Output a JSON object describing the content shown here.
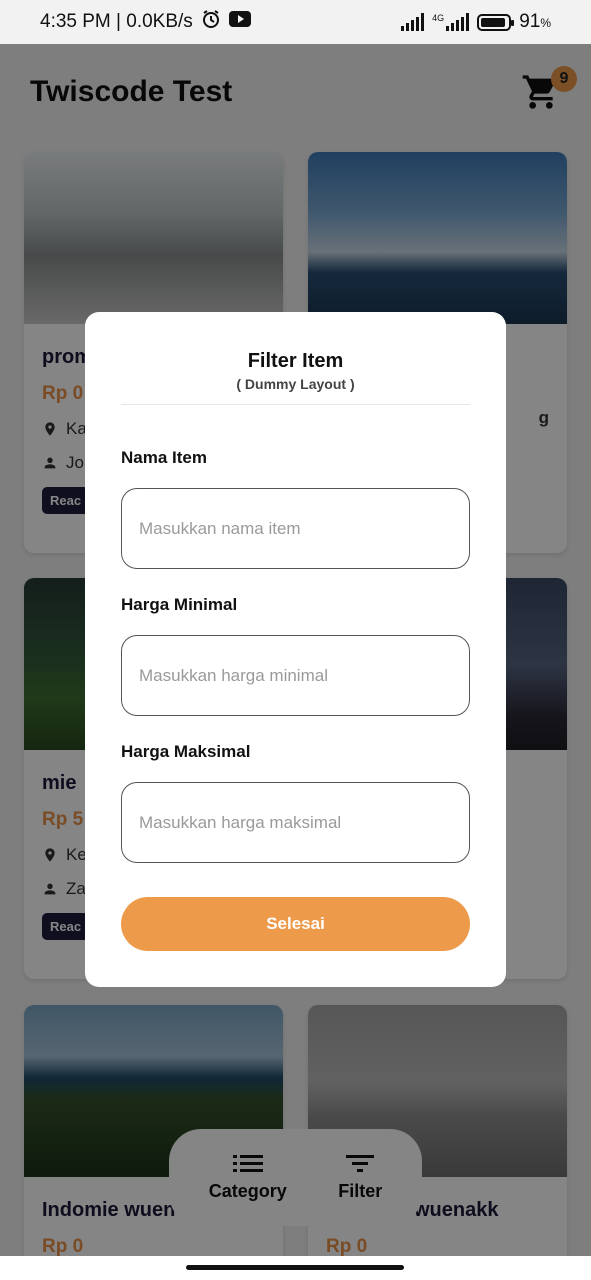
{
  "status_bar": {
    "time": "4:35 PM | 0.0KB/s",
    "network": "4G",
    "battery": "91",
    "battery_unit": "%"
  },
  "header": {
    "title": "Twiscode Test",
    "cart_count": "9"
  },
  "cards": [
    {
      "name": "prom",
      "price": "Rp 0",
      "location": "Ka",
      "user": "Jo",
      "button": "Reac"
    },
    {
      "name": "",
      "price": "",
      "location": "g",
      "user": "",
      "button": ""
    },
    {
      "name": "mie",
      "price": "Rp 5",
      "location": "Ke",
      "user": "Za",
      "button": "Reac"
    },
    {
      "name": "",
      "price": "",
      "location": "",
      "user": "",
      "button": ""
    },
    {
      "name": "Indomie wuen",
      "price": "Rp 0",
      "location": "",
      "user": "",
      "button": ""
    },
    {
      "name": "wuenakk",
      "price": "Rp 0",
      "location": "",
      "user": "",
      "button": ""
    }
  ],
  "modal": {
    "title": "Filter Item",
    "subtitle": "( Dummy Layout )",
    "fields": [
      {
        "label": "Nama Item",
        "placeholder": "Masukkan nama item",
        "value": ""
      },
      {
        "label": "Harga Minimal",
        "placeholder": "Masukkan harga minimal",
        "value": ""
      },
      {
        "label": "Harga Maksimal",
        "placeholder": "Masukkan harga maksimal",
        "value": ""
      }
    ],
    "submit_label": "Selesai"
  },
  "bottom_nav": {
    "category_label": "Category",
    "filter_label": "Filter"
  },
  "colors": {
    "accent": "#ed9a4a",
    "navy": "#1e1e3e",
    "overlay": "rgba(0,0,0,0.48)"
  }
}
